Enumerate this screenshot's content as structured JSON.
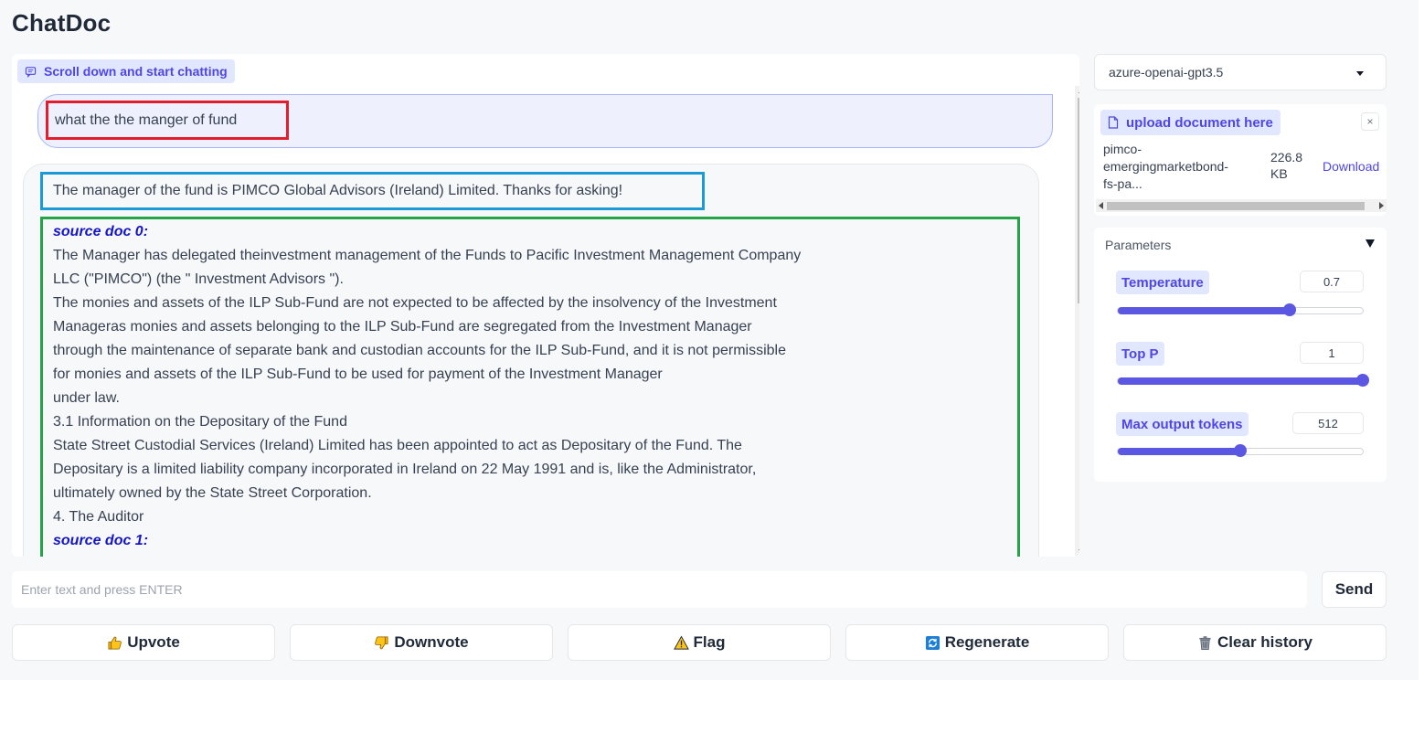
{
  "app": {
    "title": "ChatDoc"
  },
  "chat": {
    "label": "Scroll down and start chatting",
    "user_message": "what the the manger of fund",
    "bot_answer": "The manager of the fund is PIMCO Global Advisors (Ireland) Limited. Thanks for asking!",
    "sources": [
      {
        "heading": "source doc 0:",
        "lines": [
          "The Manager has delegated theinvestment management of the Funds to Pacific Investment Management Company",
          "LLC (\"PIMCO\") (the \" Investment Advisors \").",
          "The monies and assets of the ILP Sub-Fund are not expected to be affected by the insolvency of the Investment",
          "Manageras monies and assets belonging to the ILP Sub-Fund are segregated from the Investment Manager",
          "through the maintenance of separate bank and custodian accounts for the ILP Sub-Fund, and it is not permissible",
          "for monies and assets of the ILP Sub-Fund to be used for payment of the Investment Manager",
          "under law.",
          "3.1 Information on the Depositary of the Fund",
          "State Street Custodial Services (Ireland) Limited has been appointed to act as Depositary of the Fund. The",
          "Depositary is a limited liability company incorporated in Ireland on 22 May 1991 and is, like the Administrator,",
          "ultimately owned by the State Street Corporation.",
          "4. The Auditor"
        ]
      },
      {
        "heading": "source doc 1:",
        "lines": []
      }
    ]
  },
  "sidebar": {
    "model_selected": "azure-openai-gpt3.5",
    "upload": {
      "label": "upload document here",
      "close_symbol": "×",
      "file_name_lines": [
        "pimco-",
        "emergingmarketbond-",
        "fs-pa..."
      ],
      "file_size_lines": [
        "226.8",
        "KB"
      ],
      "download_label": "Download"
    },
    "parameters": {
      "title": "Parameters",
      "temperature": {
        "label": "Temperature",
        "value": "0.7",
        "fraction": 0.7
      },
      "top_p": {
        "label": "Top P",
        "value": "1",
        "fraction": 1.0
      },
      "max_tokens": {
        "label": "Max output tokens",
        "value": "512",
        "fraction": 0.5
      }
    }
  },
  "input": {
    "placeholder": "Enter text and press ENTER",
    "send_label": "Send"
  },
  "actions": {
    "upvote": "Upvote",
    "downvote": "Downvote",
    "flag": "Flag",
    "regenerate": "Regenerate",
    "clear": "Clear history"
  },
  "colors": {
    "accent": "#4f46e5",
    "slider": "#5b57e3",
    "highlight_user": "#e11d2e",
    "highlight_answer": "#1b9ad6",
    "highlight_sources": "#22a447",
    "source_heading": "#1515c8"
  }
}
